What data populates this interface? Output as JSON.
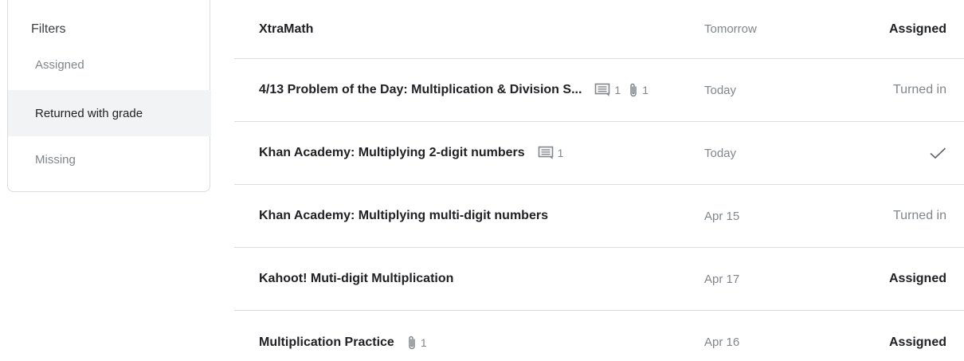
{
  "filters": {
    "title": "Filters",
    "items": [
      {
        "label": "Assigned",
        "active": false
      },
      {
        "label": "Returned with grade",
        "active": true
      },
      {
        "label": "Missing",
        "active": false
      }
    ]
  },
  "assignments": [
    {
      "title": "XtraMath",
      "comments": "",
      "attachments": "",
      "date": "Tomorrow",
      "status": "Assigned"
    },
    {
      "title": "4/13 Problem of the Day: Multiplication & Division S...",
      "comments": "1",
      "attachments": "1",
      "date": "Today",
      "status": "Turned in"
    },
    {
      "title": "Khan Academy: Multiplying 2-digit numbers",
      "comments": "1",
      "attachments": "",
      "date": "Today",
      "status": "",
      "status_icon": "checkmark-icon"
    },
    {
      "title": "Khan Academy: Multiplying multi-digit numbers",
      "comments": "",
      "attachments": "",
      "date": "Apr 15",
      "status": "Turned in"
    },
    {
      "title": "Kahoot! Muti-digit Multiplication",
      "comments": "",
      "attachments": "",
      "date": "Apr 17",
      "status": "Assigned"
    },
    {
      "title": "Multiplication Practice",
      "comments": "",
      "attachments": "1",
      "date": "Apr 16",
      "status": "Assigned"
    }
  ],
  "colors": {
    "text_primary": "#202124",
    "text_secondary": "#80868b",
    "divider": "#dadce0",
    "active_bg": "#f1f3f4"
  }
}
